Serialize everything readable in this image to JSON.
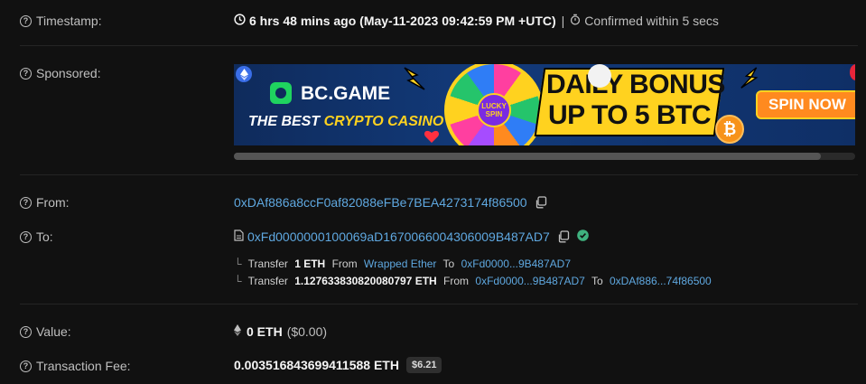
{
  "rows": {
    "timestamp": {
      "label": "Timestamp:",
      "relative": "6 hrs 48 mins ago (May-11-2023 09:42:59 PM +UTC)",
      "separator": "|",
      "confirmed": "Confirmed within 5 secs"
    },
    "sponsored": {
      "label": "Sponsored:",
      "brand": "BC.GAME",
      "tagline_prefix": "THE BEST ",
      "tagline_highlight": "CRYPTO CASINO",
      "headline_1": "DAILY BONUS",
      "headline_2": "UP TO 5 BTC",
      "cta": "SPIN NOW",
      "wheel_center": "LUCKY SPIN"
    },
    "from": {
      "label": "From:",
      "address": "0xDAf886a8ccF0af82088eFBe7BEA4273174f86500"
    },
    "to": {
      "label": "To:",
      "address": "0xFd0000000100069aD1670066004306009B487AD7",
      "transfers": [
        {
          "prefix": "Transfer",
          "amount": "1 ETH",
          "from_label": "From",
          "from": "Wrapped Ether",
          "to_label": "To",
          "to": "0xFd0000...9B487AD7"
        },
        {
          "prefix": "Transfer",
          "amount": "1.127633830820080797 ETH",
          "from_label": "From",
          "from": "0xFd0000...9B487AD7",
          "to_label": "To",
          "to": "0xDAf886...74f86500"
        }
      ]
    },
    "value": {
      "label": "Value:",
      "amount": "0 ETH",
      "usd": "($0.00)"
    },
    "fee": {
      "label": "Transaction Fee:",
      "amount": "0.003516843699411588 ETH",
      "usd_badge": "$6.21"
    }
  },
  "colors": {
    "background": "#111111",
    "link": "#5fa8e0",
    "verified": "#3fb27f",
    "banner_yellow": "#ffd21f",
    "banner_orange": "#ff8a1f"
  }
}
